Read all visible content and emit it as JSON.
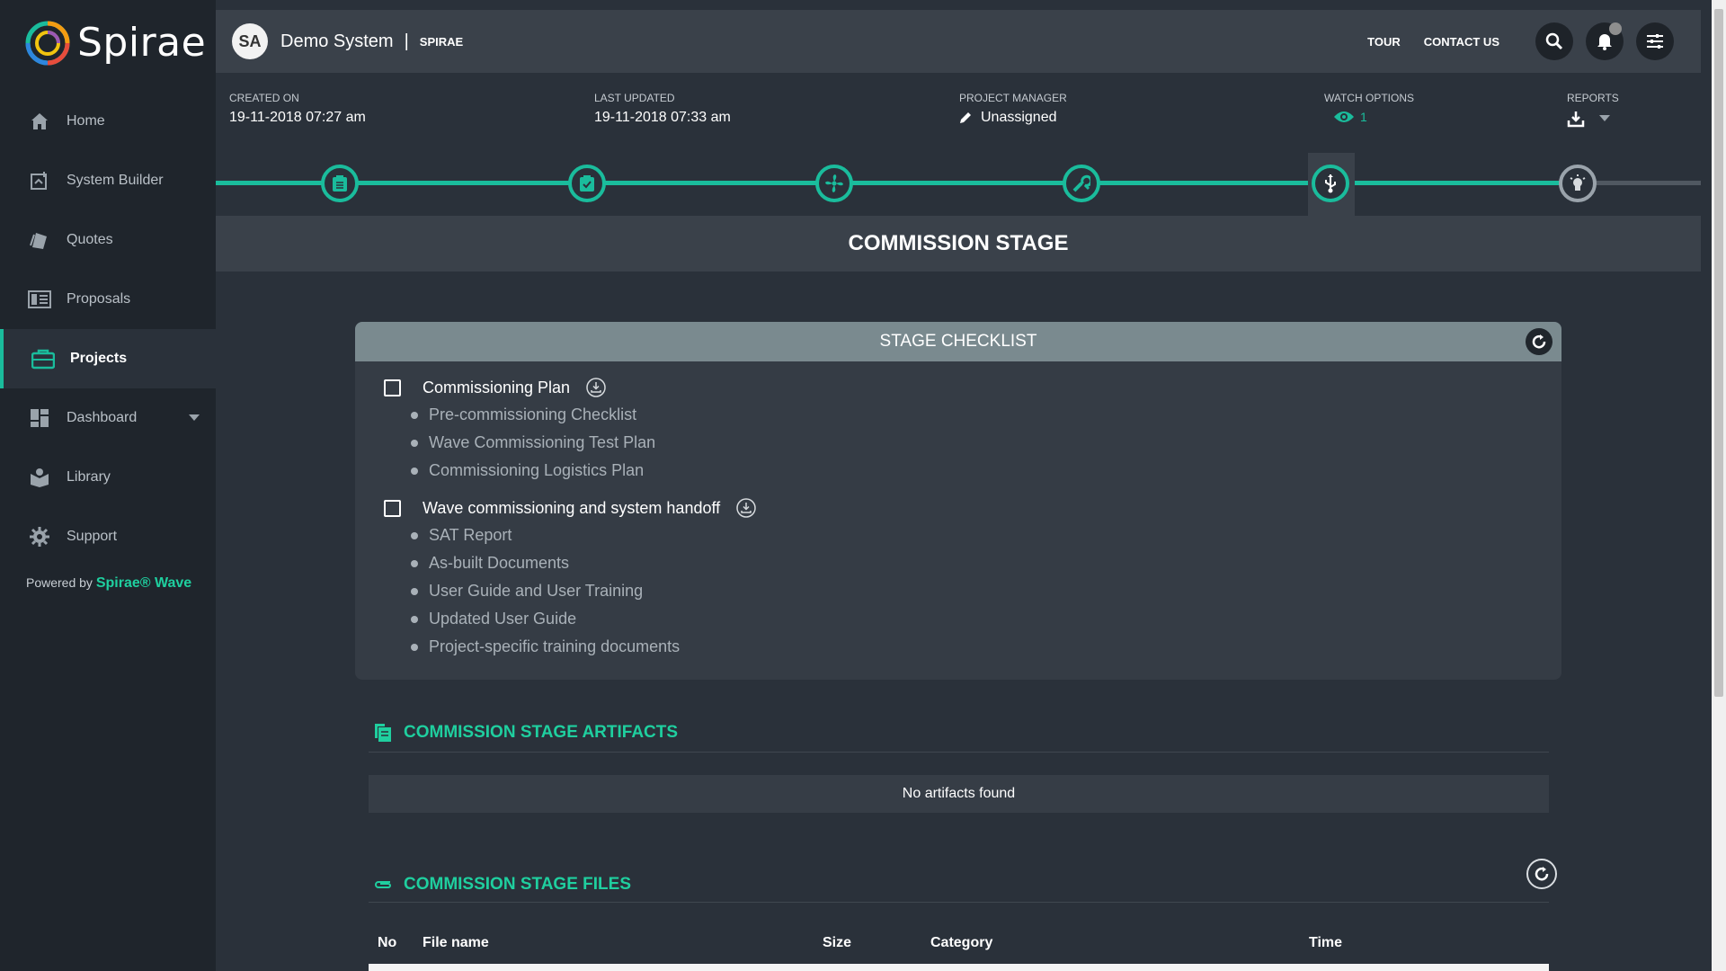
{
  "sidebar": {
    "logo_text": "Spirae",
    "items": [
      {
        "label": "Home",
        "icon": "home-icon"
      },
      {
        "label": "System Builder",
        "icon": "system-builder-icon"
      },
      {
        "label": "Quotes",
        "icon": "quotes-icon"
      },
      {
        "label": "Proposals",
        "icon": "proposals-icon"
      },
      {
        "label": "Projects",
        "icon": "briefcase-icon",
        "active": true
      },
      {
        "label": "Dashboard",
        "icon": "dashboard-icon",
        "has_caret": true
      },
      {
        "label": "Library",
        "icon": "library-icon"
      },
      {
        "label": "Support",
        "icon": "gear-icon"
      }
    ],
    "powered_by_prefix": "Powered by",
    "powered_by_brand": "Spirae® Wave"
  },
  "header": {
    "avatar_initials": "SA",
    "system_name": "Demo System",
    "separator": "|",
    "org": "SPIRAE",
    "tour_label": "TOUR",
    "contact_label": "CONTACT US"
  },
  "meta": {
    "created_label": "CREATED ON",
    "created_value": "19-11-2018 07:27 am",
    "updated_label": "LAST UPDATED",
    "updated_value": "19-11-2018 07:33 am",
    "manager_label": "PROJECT MANAGER",
    "manager_value": "Unassigned",
    "watch_label": "WATCH OPTIONS",
    "watch_count": "1",
    "reports_label": "REPORTS"
  },
  "stage": {
    "title": "COMMISSION STAGE"
  },
  "checklist": {
    "title": "STAGE CHECKLIST",
    "groups": [
      {
        "label": "Commissioning Plan",
        "items": [
          "Pre-commissioning Checklist",
          "Wave Commissioning Test Plan",
          "Commissioning Logistics Plan"
        ]
      },
      {
        "label": "Wave commissioning and system handoff",
        "items": [
          "SAT Report",
          "As-built Documents",
          "User Guide and User Training",
          "Updated User Guide",
          "Project-specific training documents"
        ]
      }
    ]
  },
  "artifacts": {
    "title": "COMMISSION STAGE ARTIFACTS",
    "empty_text": "No artifacts found"
  },
  "files": {
    "title": "COMMISSION STAGE FILES",
    "columns": [
      "No",
      "File name",
      "Size",
      "Category",
      "Time"
    ]
  },
  "colors": {
    "accent": "#1abc9c",
    "sidebar_bg": "#1f252c",
    "content_bg": "#2a313a"
  }
}
